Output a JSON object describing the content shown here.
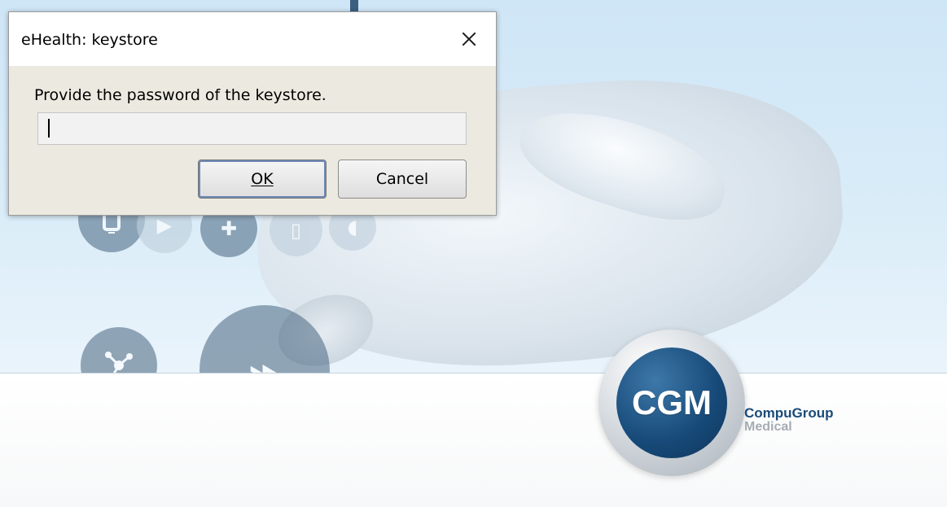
{
  "dialog": {
    "title": "eHealth: keystore",
    "message": "Provide the password of the keystore.",
    "password_value": "",
    "ok_label": "OK",
    "cancel_label": "Cancel",
    "close_icon": "close-icon"
  },
  "branding": {
    "logo_text": "CGM",
    "company_name_top": "CompuGroup",
    "company_name_bottom": "Medical",
    "logo_icon": "cgm-logo-icon"
  },
  "colors": {
    "dialog_background": "#eceae0",
    "titlebar_background": "#ffffff",
    "brand_blue": "#194b79",
    "brand_gray": "#a5acb3",
    "logo_blue": "#174a79",
    "splash_blue": "#d9ecf8"
  }
}
